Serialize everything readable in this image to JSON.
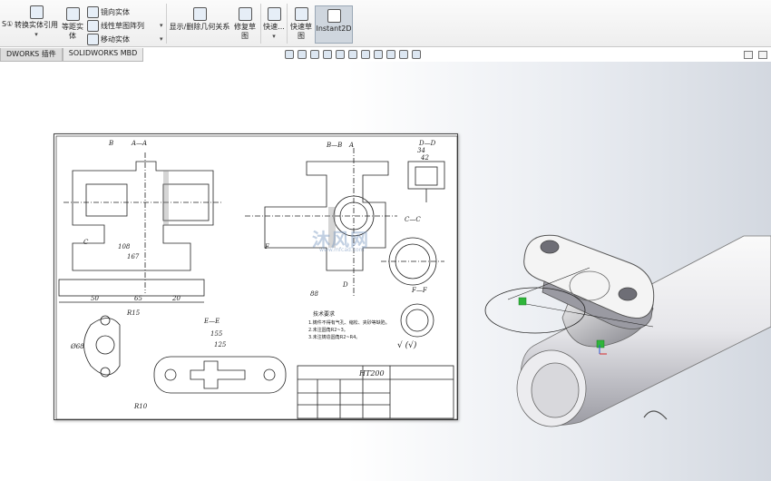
{
  "ribbon": {
    "convert_entities": "转换实体引用",
    "cut_prefix": "S①",
    "offset_entities_line1": "等距实",
    "offset_entities_line2": "体",
    "mirror_entities": "镜向实体",
    "linear_pattern": "线性草图阵列",
    "move_entities": "移动实体",
    "show_delete_relations": "显示/删除几何关系",
    "repair_sketch_line1": "修复草",
    "repair_sketch_line2": "图",
    "quick_snaps": "快速...",
    "rapid_sketch_line1": "快速草",
    "rapid_sketch_line2": "图",
    "instant2d": "Instant2D"
  },
  "tabs": [
    "DWORKS 插件",
    "SOLIDWORKS MBD"
  ],
  "drawing": {
    "section_aa": "A—A",
    "section_bb": "B—B",
    "section_cc": "C—C",
    "section_dd": "D—D",
    "section_ee": "E—E",
    "section_ff": "F—F",
    "label_b": "B",
    "label_a": "A",
    "label_d": "D",
    "label_c": "C",
    "label_f": "F",
    "tech_req_title": "技术要求",
    "tech_req_1": "1.铸件不得有气孔、缩松、夹砂等缺陷。",
    "tech_req_2": "2.未注圆角R2~3。",
    "tech_req_3": "3.未注铸造圆角R2~R4。",
    "material": "HT200",
    "r15": "R15",
    "r10": "R10",
    "dim_155": "155",
    "dim_125": "125",
    "dim_88": "88",
    "dim_65": "65",
    "dim_50": "50",
    "dim_20": "20",
    "dim_34": "34",
    "dim_42": "42",
    "dim_66": "Ø68",
    "dim_167": "167",
    "dim_108": "108",
    "surface_note": "√ (√)"
  },
  "watermark": {
    "text": "沐风网",
    "domain": "www.mfcad.com"
  },
  "colors": {
    "ribbon_bg": "#eeeeee",
    "active_button": "#cfd6de",
    "viewport_grad_end": "#d3d8e0",
    "model_face": "#f2f2f2",
    "model_shade": "#8d8d92",
    "sketch_green": "#2fb53a"
  }
}
